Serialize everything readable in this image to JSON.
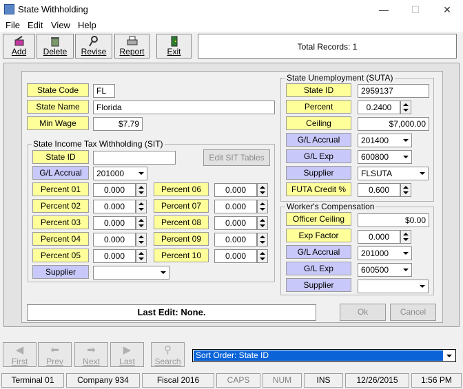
{
  "window": {
    "title": "State Withholding",
    "controls": {
      "minimize": "—",
      "maximize": "☐",
      "close": "✕"
    }
  },
  "menu": [
    "File",
    "Edit",
    "View",
    "Help"
  ],
  "toolbar": {
    "add": "Add",
    "delete": "Delete",
    "revise": "Revise",
    "report": "Report",
    "exit": "Exit",
    "total_records": "Total Records: 1"
  },
  "state": {
    "code_label": "State Code",
    "code": "FL",
    "name_label": "State Name",
    "name": "Florida",
    "minwage_label": "Min Wage",
    "minwage": "$7.79"
  },
  "sit": {
    "title": "State Income Tax Withholding (SIT)",
    "state_id_label": "State ID",
    "state_id": "",
    "edit_tables": "Edit SIT Tables",
    "gl_label": "G/L Accrual",
    "gl": "201000",
    "percents": [
      {
        "label": "Percent 01",
        "value": "0.000"
      },
      {
        "label": "Percent 02",
        "value": "0.000"
      },
      {
        "label": "Percent 03",
        "value": "0.000"
      },
      {
        "label": "Percent 04",
        "value": "0.000"
      },
      {
        "label": "Percent 05",
        "value": "0.000"
      },
      {
        "label": "Percent 06",
        "value": "0.000"
      },
      {
        "label": "Percent 07",
        "value": "0.000"
      },
      {
        "label": "Percent 08",
        "value": "0.000"
      },
      {
        "label": "Percent 09",
        "value": "0.000"
      },
      {
        "label": "Percent 10",
        "value": "0.000"
      }
    ],
    "supplier_label": "Supplier",
    "supplier": ""
  },
  "suta": {
    "title": "State Unemployment (SUTA)",
    "state_id_label": "State ID",
    "state_id": "2959137",
    "percent_label": "Percent",
    "percent": "0.2400",
    "ceiling_label": "Ceiling",
    "ceiling": "$7,000.00",
    "gl_accrual_label": "G/L Accrual",
    "gl_accrual": "201400",
    "gl_exp_label": "G/L Exp",
    "gl_exp": "600800",
    "supplier_label": "Supplier",
    "supplier": "FLSUTA",
    "futa_label": "FUTA Credit %",
    "futa": "0.600"
  },
  "wc": {
    "title": "Worker's Compensation",
    "officer_label": "Officer Ceiling",
    "officer": "$0.00",
    "exp_factor_label": "Exp Factor",
    "exp_factor": "0.000",
    "gl_accrual_label": "G/L Accrual",
    "gl_accrual": "201000",
    "gl_exp_label": "G/L Exp",
    "gl_exp": "600500",
    "supplier_label": "Supplier",
    "supplier": ""
  },
  "last_edit": "Last Edit: None.",
  "buttons": {
    "ok": "Ok",
    "cancel": "Cancel"
  },
  "nav": {
    "first": "First",
    "prev": "Prev",
    "next": "Next",
    "last": "Last",
    "search": "Search"
  },
  "sort": {
    "value": "Sort Order: State ID"
  },
  "status": {
    "terminal": "Terminal 01",
    "company": "Company 934",
    "fiscal": "Fiscal 2016",
    "caps": "CAPS",
    "num": "NUM",
    "ins": "INS",
    "date": "12/26/2015",
    "time": "1:56 PM"
  }
}
